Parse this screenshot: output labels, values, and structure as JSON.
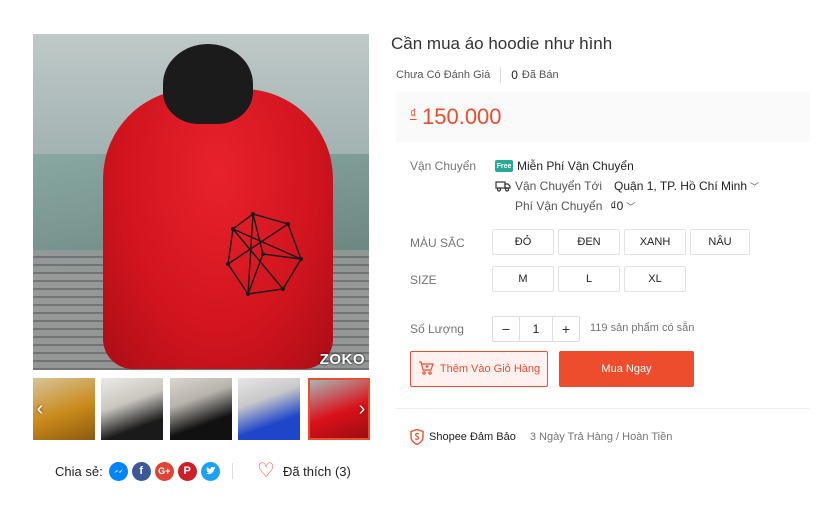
{
  "gallery": {
    "watermark": "ZOKO",
    "thumbnails": [
      "thumb-yellow-hoodie",
      "thumb-black-hoodie",
      "thumb-black-hoodie-2",
      "thumb-blue-hoodie",
      "thumb-red-hoodie"
    ],
    "prev_icon": "chevron-left-icon",
    "next_icon": "chevron-right-icon"
  },
  "share": {
    "label": "Chia sẻ:",
    "networks": [
      "messenger-icon",
      "facebook-icon",
      "google-plus-icon",
      "pinterest-icon",
      "twitter-icon"
    ]
  },
  "like": {
    "label": "Đã thích (3)"
  },
  "product": {
    "title": "Cần mua áo hoodie như hình",
    "rating_text": "Chưa Có Đánh Giá",
    "sold_count": "0",
    "sold_label": "Đã Bán",
    "currency": "₫",
    "price": "150.000"
  },
  "shipping": {
    "label": "Vận Chuyển",
    "free_badge": "Free",
    "free_text": "Miễn Phí Vận Chuyển",
    "to_label": "Vận Chuyển Tới",
    "destination": "Quận 1, TP. Hồ Chí Minh",
    "fee_label": "Phí Vận Chuyển",
    "fee_value": "₫0"
  },
  "color": {
    "label": "MÀU SẮC",
    "options": [
      "ĐỎ",
      "ĐEN",
      "XANH",
      "NÂU"
    ]
  },
  "size": {
    "label": "SIZE",
    "options": [
      "M",
      "L",
      "XL"
    ]
  },
  "quantity": {
    "label": "Số Lượng",
    "minus": "−",
    "plus": "+",
    "value": "1",
    "stock": "119 sản phẩm có sẵn"
  },
  "actions": {
    "add_to_cart": "Thêm Vào Giỏ Hàng",
    "buy_now": "Mua Ngay"
  },
  "guarantee": {
    "brand": "Shopee Đảm Bảo",
    "policy": "3 Ngày Trả Hàng / Hoàn Tiền"
  },
  "colors": {
    "accent": "#ee4d2d",
    "freeship": "#26aa99"
  }
}
